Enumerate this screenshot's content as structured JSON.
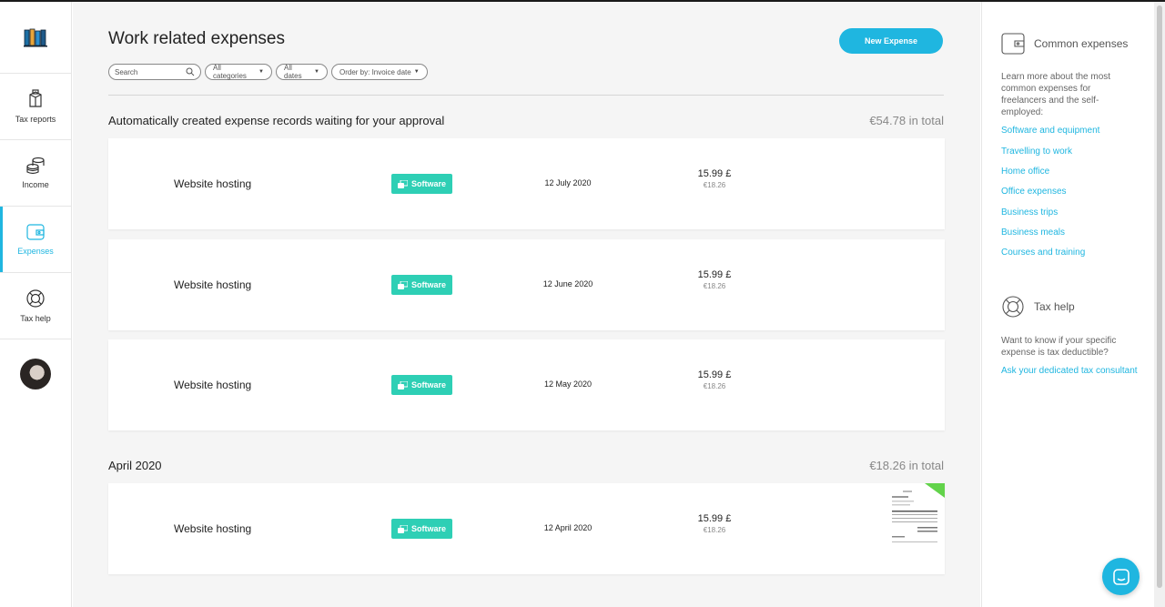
{
  "nav": {
    "logo_icon": "books-icon",
    "items": [
      {
        "label": "Tax reports",
        "icon": "box-icon"
      },
      {
        "label": "Income",
        "icon": "coins-icon"
      },
      {
        "label": "Expenses",
        "icon": "wallet-icon"
      },
      {
        "label": "Tax help",
        "icon": "lifebuoy-icon"
      }
    ]
  },
  "main": {
    "title": "Work related expenses",
    "new_button": "New Expense",
    "search_placeholder": "Search",
    "filters": {
      "categories": "All categories",
      "dates": "All dates",
      "order_prefix": "Order by:",
      "order_value": "Invoice date"
    },
    "pending": {
      "title": "Automatically created expense records waiting for your approval",
      "total": "€54.78 in total",
      "rows": [
        {
          "name": "Website hosting",
          "category": "Software",
          "date": "12 July 2020",
          "amount": "15.99 £",
          "converted": "€18.26"
        },
        {
          "name": "Website hosting",
          "category": "Software",
          "date": "12 June 2020",
          "amount": "15.99 £",
          "converted": "€18.26"
        },
        {
          "name": "Website hosting",
          "category": "Software",
          "date": "12 May 2020",
          "amount": "15.99 £",
          "converted": "€18.26"
        }
      ]
    },
    "april": {
      "title": "April 2020",
      "total": "€18.26 in total",
      "rows": [
        {
          "name": "Website hosting",
          "category": "Software",
          "date": "12 April 2020",
          "amount": "15.99 £",
          "converted": "€18.26"
        }
      ]
    }
  },
  "aside": {
    "common": {
      "title": "Common expenses",
      "text": "Learn more about the most common expenses for freelancers and the self-employed:",
      "links": [
        "Software and equipment",
        "Travelling to work",
        "Home office",
        "Office expenses",
        "Business trips",
        "Business meals",
        "Courses and training"
      ]
    },
    "help": {
      "title": "Tax help",
      "text": "Want to know if your specific expense is tax deductible?",
      "link": "Ask your dedicated tax consultant"
    }
  },
  "colors": {
    "accent": "#1fb6e0",
    "badge": "#2ecfb5",
    "background": "#f5f5f5"
  }
}
